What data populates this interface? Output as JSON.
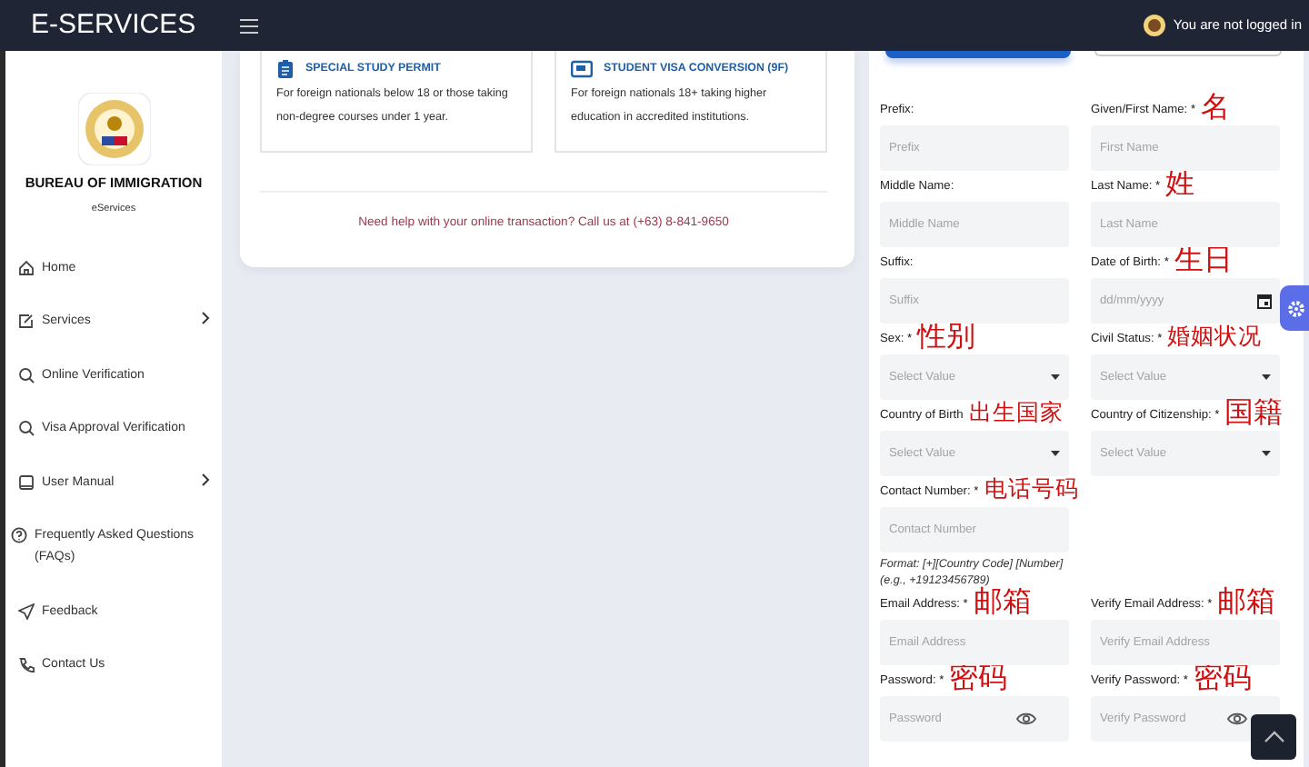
{
  "navbar": {
    "brand": "E-SERVICES",
    "user_status": "You are not logged in"
  },
  "sidebar": {
    "agency": "BUREAU OF IMMIGRATION",
    "subtitle": "eServices",
    "items": [
      {
        "label": "Home",
        "has_submenu": false
      },
      {
        "label": "Services",
        "has_submenu": true
      },
      {
        "label": "Online Verification",
        "has_submenu": false
      },
      {
        "label": "Visa Approval Verification",
        "has_submenu": false
      },
      {
        "label": "User Manual",
        "has_submenu": true
      },
      {
        "label": "Frequently Asked Questions (FAQs)",
        "has_submenu": false
      },
      {
        "label": "Feedback",
        "has_submenu": false
      },
      {
        "label": "Contact Us",
        "has_submenu": false
      }
    ]
  },
  "services": [
    {
      "title": "SPECIAL STUDY PERMIT",
      "description": "For foreign nationals below 18 or those taking non-degree courses under 1 year."
    },
    {
      "title": "STUDENT VISA CONVERSION (9F)",
      "description": "For foreign nationals 18+ taking higher education in accredited institutions."
    }
  ],
  "help_text": "Need help with your online transaction? Call us at (+63) 8-841-9650",
  "form": {
    "rows": [
      [
        {
          "label": "Prefix:",
          "kind": "text",
          "placeholder": "Prefix"
        },
        {
          "label": "Given/First Name: *",
          "note": "名",
          "kind": "text",
          "placeholder": "First Name"
        }
      ],
      [
        {
          "label": "Middle Name:",
          "kind": "text",
          "placeholder": "Middle Name"
        },
        {
          "label": "Last Name: *",
          "note": "姓",
          "kind": "text",
          "placeholder": "Last Name"
        }
      ],
      [
        {
          "label": "Suffix:",
          "kind": "text",
          "placeholder": "Suffix"
        },
        {
          "label": "Date of Birth: *",
          "note": "生日",
          "kind": "date",
          "placeholder": "dd/mm/yyyy"
        }
      ],
      [
        {
          "label": "Sex: *",
          "note": "性别",
          "kind": "select",
          "placeholder": "Select Value"
        },
        {
          "label": "Civil Status: *",
          "note": "婚姻状况",
          "kind": "select",
          "placeholder": "Select Value"
        }
      ],
      [
        {
          "label": "Country of Birth",
          "note": "出生国家",
          "kind": "select",
          "placeholder": "Select Value"
        },
        {
          "label": "Country of Citizenship: *",
          "note": "国籍",
          "kind": "select",
          "placeholder": "Select Value"
        }
      ],
      [
        {
          "label": "Contact Number: *",
          "note": "电话号码",
          "kind": "text",
          "placeholder": "Contact Number",
          "hint": "Format: [+][Country Code] [Number] (e.g., +19123456789)"
        }
      ],
      [
        {
          "label": "Email Address: *",
          "note": "邮箱",
          "kind": "text",
          "placeholder": "Email Address"
        },
        {
          "label": "Verify Email Address: *",
          "note": "邮箱",
          "kind": "text",
          "placeholder": "Verify Email Address"
        }
      ],
      [
        {
          "label": "Password: *",
          "note": "密码",
          "kind": "password",
          "placeholder": "Password"
        },
        {
          "label": "Verify Password: *",
          "note": "密码",
          "kind": "password",
          "placeholder": "Verify Password"
        }
      ]
    ]
  }
}
